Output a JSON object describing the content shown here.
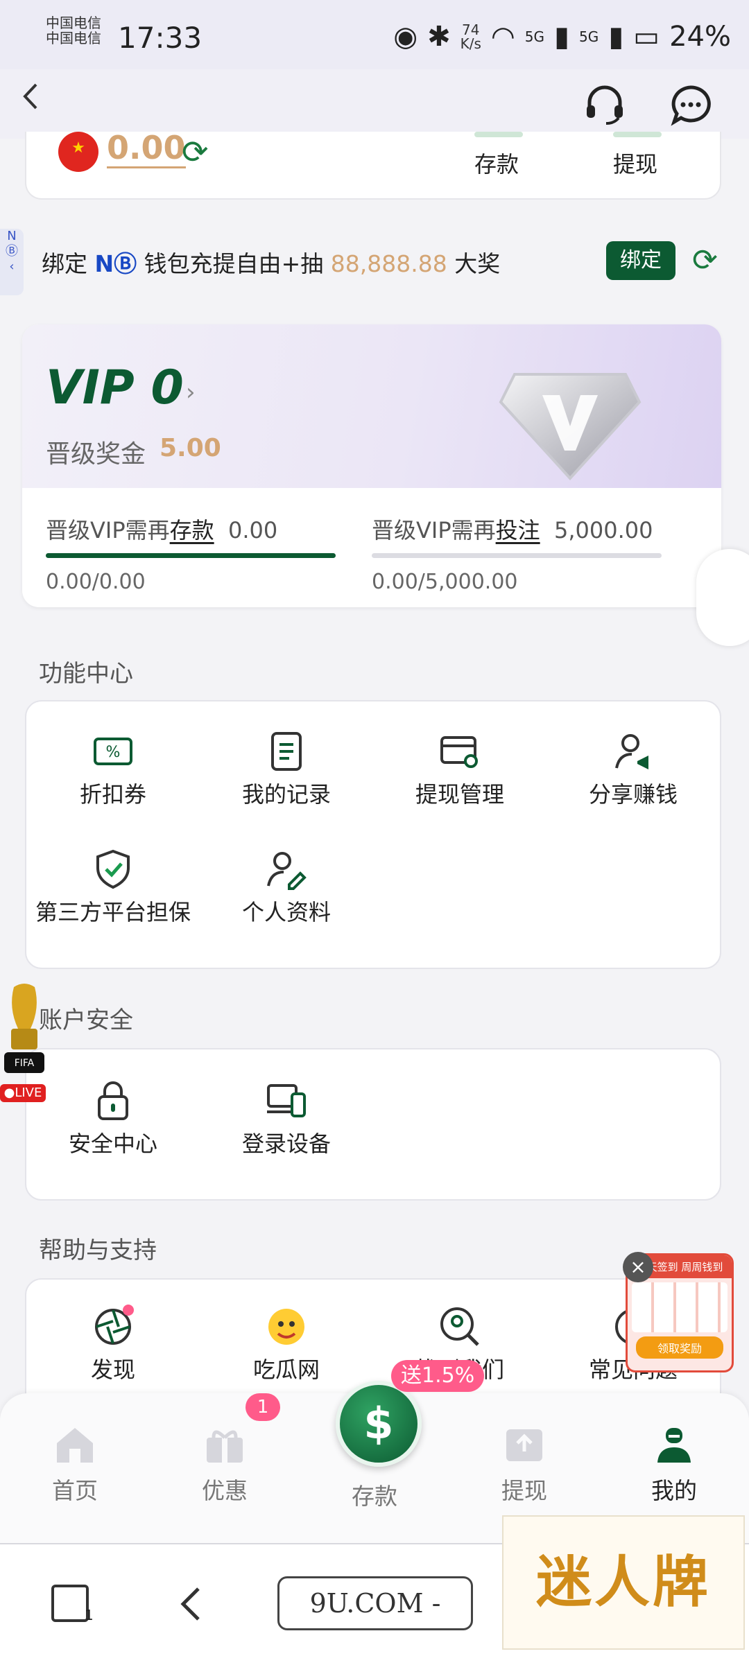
{
  "status_bar": {
    "carrier": "中国电信 中国电信",
    "time": "17:33",
    "net_speed_value": "74",
    "net_speed_unit": "K/s",
    "signal_1": "5G",
    "signal_2": "5G",
    "battery": "24%"
  },
  "wallet": {
    "balance": "0.00",
    "deposit_label": "存款",
    "withdraw_label": "提现"
  },
  "bind_banner": {
    "prefix": "绑定",
    "brand": "NⒷ",
    "middle": "钱包充提自由+抽",
    "amount": "88,888.88",
    "suffix": "大奖",
    "button": "绑定",
    "side_tab": "N"
  },
  "vip": {
    "title": "VIP 0",
    "bonus_label": "晋级奖金",
    "bonus_value": "5.00",
    "deposit_req_prefix": "晋级VIP需再",
    "deposit_req_key": "存款",
    "deposit_req_value": "0.00",
    "deposit_progress_text": "0.00/0.00",
    "deposit_progress": 1.0,
    "bet_req_prefix": "晋级VIP需再",
    "bet_req_key": "投注",
    "bet_req_value": "5,000.00",
    "bet_progress_text": "0.00/5,000.00",
    "bet_progress": 0.0
  },
  "function_center": {
    "title": "功能中心",
    "items": [
      "折扣券",
      "我的记录",
      "提现管理",
      "分享赚钱",
      "第三方平台担保",
      "个人资料"
    ]
  },
  "account_security": {
    "title": "账户安全",
    "items": [
      "安全中心",
      "登录设备"
    ]
  },
  "help_support": {
    "title": "帮助与支持",
    "items": [
      "发现",
      "吃瓜网",
      "找到我们",
      "常见问题"
    ]
  },
  "floating": {
    "live_label": "LIVE",
    "fifa_label": "FIFA",
    "signin_title": "天天签到 周周钱到",
    "signin_button": "领取奖励"
  },
  "bottom_nav": {
    "home": "首页",
    "promo": "优惠",
    "promo_badge": "1",
    "deposit": "存款",
    "deposit_promo": "送1.5%",
    "withdraw": "提现",
    "mine": "我的"
  },
  "browser": {
    "tab_count": "1",
    "url": "9U.COM -",
    "ad_text": "迷人牌"
  },
  "colors": {
    "primary_green": "#0c5a32",
    "gold": "#d4a574",
    "badge_pink": "#ff5b8a"
  }
}
